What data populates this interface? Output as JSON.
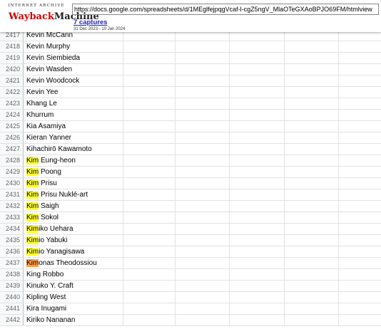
{
  "wayback": {
    "logo_top": "INTERNET ARCHIVE",
    "logo_main_1": "Wayback",
    "logo_main_2": "Machine",
    "url": "https://docs.google.com/spreadsheets/d/1MEglfejpqgVcaf-l-cgZ5ngV_MlaOTeGXAoBPJO69FM/htmlview",
    "captures": "7 captures",
    "date_range": "31 Dec 2023 - 10 Jan 2024"
  },
  "rows": [
    {
      "num": "2417",
      "pre": "",
      "hl": "",
      "post": "Kevin McCann",
      "hl_color": "none"
    },
    {
      "num": "2418",
      "pre": "",
      "hl": "",
      "post": "Kevin Murphy",
      "hl_color": "none"
    },
    {
      "num": "2419",
      "pre": "",
      "hl": "",
      "post": "Kevin Siembieda",
      "hl_color": "none"
    },
    {
      "num": "2420",
      "pre": "",
      "hl": "",
      "post": "Kevin Wasden",
      "hl_color": "none"
    },
    {
      "num": "2421",
      "pre": "",
      "hl": "",
      "post": "Kevin Woodcock",
      "hl_color": "none"
    },
    {
      "num": "2422",
      "pre": "",
      "hl": "",
      "post": "Kevin Yee",
      "hl_color": "none"
    },
    {
      "num": "2423",
      "pre": "",
      "hl": "",
      "post": "Khang Le",
      "hl_color": "none"
    },
    {
      "num": "2424",
      "pre": "",
      "hl": "",
      "post": "Khurrum",
      "hl_color": "none"
    },
    {
      "num": "2425",
      "pre": "",
      "hl": "",
      "post": "Kia Asamiya",
      "hl_color": "none"
    },
    {
      "num": "2426",
      "pre": "",
      "hl": "",
      "post": "Kieran Yanner",
      "hl_color": "none"
    },
    {
      "num": "2427",
      "pre": "",
      "hl": "",
      "post": "Kihachirō Kawamoto",
      "hl_color": "none"
    },
    {
      "num": "2428",
      "pre": "",
      "hl": "Kim",
      "post": " Eung-heon",
      "hl_color": "yellow"
    },
    {
      "num": "2429",
      "pre": "",
      "hl": "Kim",
      "post": " Poong",
      "hl_color": "yellow"
    },
    {
      "num": "2430",
      "pre": "",
      "hl": "Kim",
      "post": " Prisu",
      "hl_color": "yellow"
    },
    {
      "num": "2431",
      "pre": "",
      "hl": "Kim",
      "post": " Prisu Nuklé-art",
      "hl_color": "yellow"
    },
    {
      "num": "2432",
      "pre": "",
      "hl": "Kim",
      "post": " Saigh",
      "hl_color": "yellow"
    },
    {
      "num": "2433",
      "pre": "",
      "hl": "Kim",
      "post": " Sokol",
      "hl_color": "yellow"
    },
    {
      "num": "2434",
      "pre": "",
      "hl": "Kim",
      "post": "iko Uehara",
      "hl_color": "yellow"
    },
    {
      "num": "2435",
      "pre": "",
      "hl": "Kim",
      "post": "io Yabuki",
      "hl_color": "yellow"
    },
    {
      "num": "2436",
      "pre": "",
      "hl": "Kim",
      "post": "io Yanagisawa",
      "hl_color": "yellow"
    },
    {
      "num": "2437",
      "pre": "",
      "hl": "Kim",
      "post": "onas Theodossiou",
      "hl_color": "orange"
    },
    {
      "num": "2438",
      "pre": "",
      "hl": "",
      "post": "King Robbo",
      "hl_color": "none"
    },
    {
      "num": "2439",
      "pre": "",
      "hl": "",
      "post": "Kinuko Y. Craft",
      "hl_color": "none"
    },
    {
      "num": "2440",
      "pre": "",
      "hl": "",
      "post": "Kipling West",
      "hl_color": "none"
    },
    {
      "num": "2441",
      "pre": "",
      "hl": "",
      "post": "Kira Inugami",
      "hl_color": "none"
    },
    {
      "num": "2442",
      "pre": "",
      "hl": "",
      "post": "Kiriko Nananan",
      "hl_color": "none"
    }
  ]
}
